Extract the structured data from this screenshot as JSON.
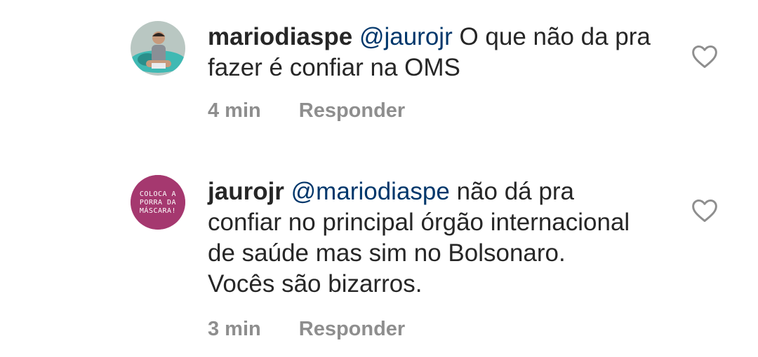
{
  "comments": [
    {
      "username": "mariodiaspe",
      "mention": "@jaurojr",
      "text": "O que não da pra fazer é confiar na OMS",
      "time": "4 min",
      "reply_label": "Responder",
      "avatar": "profile-photo"
    },
    {
      "username": "jaurojr",
      "mention": "@mariodiaspe",
      "text": "não dá pra confiar no principal órgão internacional de saúde mas sim no Bolsonaro. Vocês são bizarros.",
      "time": "3 min",
      "reply_label": "Responder",
      "avatar_lines": [
        "COLOCA A",
        "PORRA DA",
        "MÁSCARA!"
      ],
      "avatar_color": "#a5386f"
    }
  ],
  "icons": {
    "like": "heart-outline-icon"
  },
  "colors": {
    "mention": "#00376b",
    "meta": "#8e8e8e",
    "text": "#262626"
  }
}
